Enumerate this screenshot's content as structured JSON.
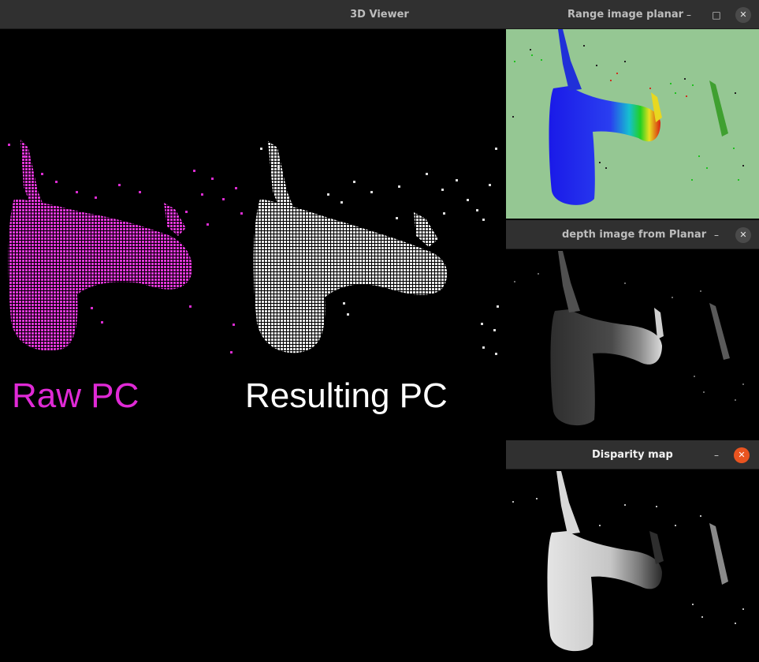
{
  "main_window": {
    "title": "3D Viewer",
    "caption_raw": "Raw PC",
    "caption_result": "Resulting PC",
    "colors": {
      "raw": "#e02ad6",
      "result": "#ffffff",
      "background": "#000000"
    }
  },
  "range_window": {
    "title": "Range image planar",
    "minimize_icon": "–",
    "maximize_icon": "□",
    "close_icon": "✕",
    "colors": {
      "background": "#95c793"
    }
  },
  "depth_window": {
    "title": "depth image from Planar",
    "minimize_icon": "–",
    "close_icon": "✕"
  },
  "disparity_window": {
    "title": "Disparity map",
    "minimize_icon": "–",
    "close_icon": "✕",
    "colors": {
      "close_active": "#e95420"
    }
  }
}
